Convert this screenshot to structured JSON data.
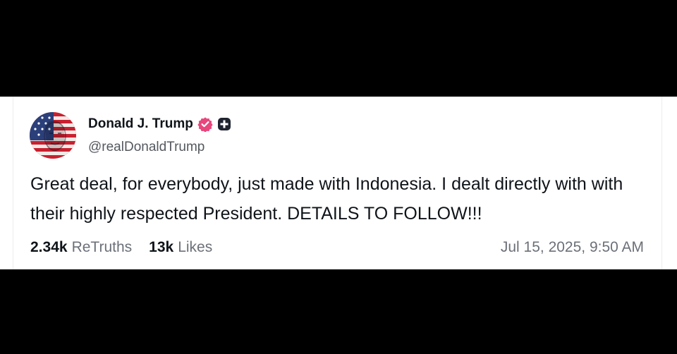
{
  "post": {
    "author": {
      "display_name": "Donald J. Trump",
      "handle": "@realDonaldTrump",
      "verified": true,
      "badge_icon": "plus-badge-icon"
    },
    "text": "Great deal, for everybody, just made with Indonesia. I dealt directly with with their highly respected President. DETAILS TO FOLLOW!!!",
    "stats": {
      "retruths_count": "2.34k",
      "retruths_label": "ReTruths",
      "likes_count": "13k",
      "likes_label": "Likes"
    },
    "timestamp": "Jul 15, 2025, 9:50 AM"
  },
  "colors": {
    "background": "#000000",
    "card": "#ffffff",
    "text": "#0f1419",
    "muted": "#6b7078",
    "verified_badge": "#e8467c"
  }
}
